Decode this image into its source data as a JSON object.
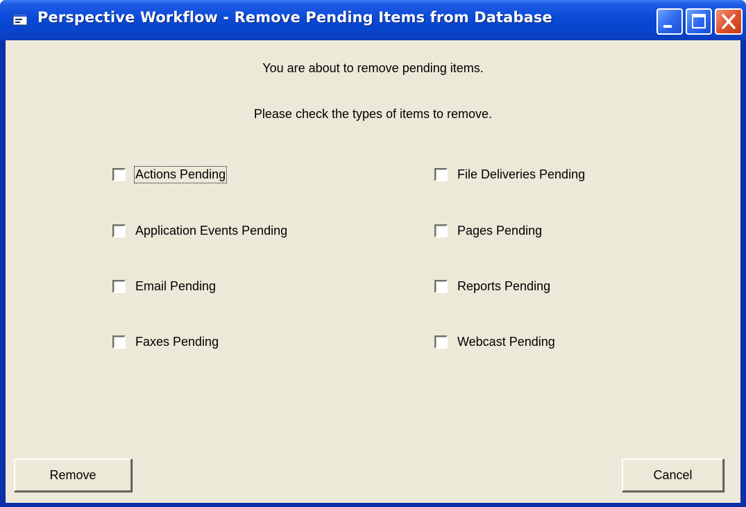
{
  "window": {
    "title": "Perspective Workflow - Remove Pending Items from Database"
  },
  "messages": {
    "line1": "You are about to remove pending items.",
    "line2": "Please check the types of items to remove."
  },
  "checkboxes": {
    "left": [
      {
        "label": "Actions Pending",
        "checked": false
      },
      {
        "label": "Application Events Pending",
        "checked": false
      },
      {
        "label": "Email Pending",
        "checked": false
      },
      {
        "label": "Faxes Pending",
        "checked": false
      }
    ],
    "right": [
      {
        "label": "File Deliveries Pending",
        "checked": false
      },
      {
        "label": "Pages Pending",
        "checked": false
      },
      {
        "label": "Reports Pending",
        "checked": false
      },
      {
        "label": "Webcast Pending",
        "checked": false
      }
    ]
  },
  "buttons": {
    "remove": "Remove",
    "cancel": "Cancel"
  },
  "colors": {
    "titlebar": "#0a4ad6",
    "client_bg": "#ece9d8",
    "close_button": "#e0552f"
  }
}
